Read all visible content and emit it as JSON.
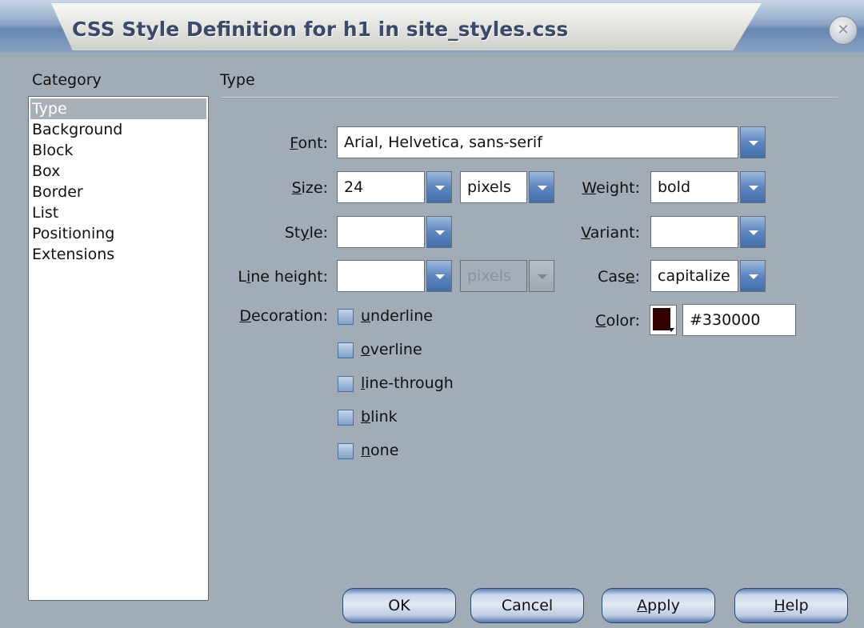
{
  "window": {
    "title": "CSS Style Definition for h1 in site_styles.css"
  },
  "category": {
    "label": "Category",
    "items": [
      {
        "label": "Type",
        "selected": true
      },
      {
        "label": "Background"
      },
      {
        "label": "Block"
      },
      {
        "label": "Box"
      },
      {
        "label": "Border"
      },
      {
        "label": "List"
      },
      {
        "label": "Positioning"
      },
      {
        "label": "Extensions"
      }
    ]
  },
  "panel": {
    "heading": "Type",
    "font": {
      "label_pre": "",
      "label_key": "F",
      "label_post": "ont:",
      "value": "Arial, Helvetica, sans-serif"
    },
    "size": {
      "label_key": "S",
      "label_post": "ize:",
      "value": "24",
      "unit": "pixels"
    },
    "weight": {
      "label_key": "W",
      "label_post": "eight:",
      "value": "bold"
    },
    "style": {
      "label_pre": "St",
      "label_key": "y",
      "label_post": "le:",
      "value": ""
    },
    "variant": {
      "label_key": "V",
      "label_post": "ariant:",
      "value": ""
    },
    "line_height": {
      "label_pre": "L",
      "label_key": "i",
      "label_post": "ne height:",
      "value": "",
      "unit": "pixels"
    },
    "case": {
      "label_pre": "Cas",
      "label_key": "e",
      "label_post": ":",
      "value": "capitalize"
    },
    "decoration": {
      "label_key": "D",
      "label_post": "ecoration:",
      "options": [
        {
          "key": "u",
          "rest": "nderline"
        },
        {
          "key": "o",
          "rest": "verline"
        },
        {
          "key": "l",
          "rest": "ine-through"
        },
        {
          "key": "b",
          "rest": "link"
        },
        {
          "key": "n",
          "rest": "one"
        }
      ]
    },
    "color": {
      "label_key": "C",
      "label_post": "olor:",
      "value": "#330000",
      "swatch": "#330000"
    }
  },
  "buttons": {
    "ok": "OK",
    "cancel": "Cancel",
    "apply_key": "A",
    "apply_rest": "pply",
    "help_key": "H",
    "help_rest": "elp"
  },
  "icons": {
    "close": "close-icon",
    "dropdown": "chevron-down-icon",
    "swatch_arrow": "dropdown-arrow-icon"
  }
}
